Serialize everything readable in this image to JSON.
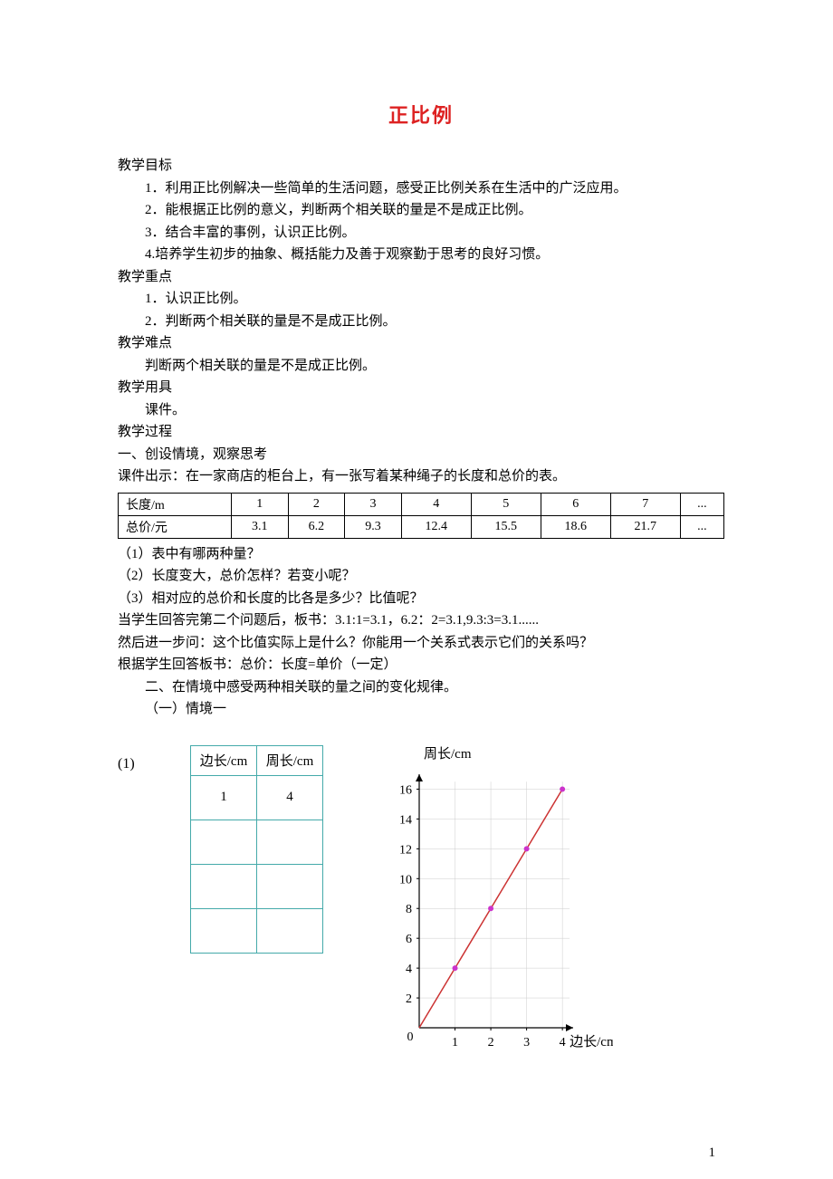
{
  "title": "正比例",
  "sections": {
    "objectives_label": "教学目标",
    "objectives": [
      "1．利用正比例解决一些简单的生活问题，感受正比例关系在生活中的广泛应用。",
      "2．能根据正比例的意义，判断两个相关联的量是不是成正比例。",
      "3．结合丰富的事例，认识正比例。",
      "4.培养学生初步的抽象、概括能力及善于观察勤于思考的良好习惯。"
    ],
    "keypoints_label": "教学重点",
    "keypoints": [
      "1．认识正比例。",
      "2．判断两个相关联的量是不是成正比例。"
    ],
    "difficulty_label": "教学难点",
    "difficulty": "判断两个相关联的量是不是成正比例。",
    "materials_label": "教学用具",
    "materials": "课件。",
    "process_label": "教学过程",
    "part1_heading": "一、创设情境，观察思考",
    "part1_intro": "课件出示：在一家商店的柜台上，有一张写着某种绳子的长度和总价的表。",
    "table1": {
      "row_headers": [
        "长度/m",
        "总价/元"
      ],
      "cols": [
        "1",
        "2",
        "3",
        "4",
        "5",
        "6",
        "7",
        "..."
      ],
      "row2": [
        "3.1",
        "6.2",
        "9.3",
        "12.4",
        "15.5",
        "18.6",
        "21.7",
        "..."
      ]
    },
    "q1": "（1）表中有哪两种量？",
    "q2": "（2）长度变大，总价怎样？若变小呢？",
    "q3": "（3）相对应的总价和长度的比各是多少？比值呢？",
    "followup1": "当学生回答完第二个问题后，板书：3.1:1=3.1，6.2：2=3.1,9.3:3=3.1......",
    "followup2": "然后进一步问：这个比值实际上是什么？你能用一个关系式表示它们的关系吗？",
    "followup3": "根据学生回答板书：总价：长度=单价（一定）",
    "part2_heading": "二、在情境中感受两种相关联的量之间的变化规律。",
    "part2_sub": "（一）情境一",
    "item_label": "(1)",
    "table2": {
      "headers": [
        "边长/cm",
        "周长/cm"
      ],
      "rows": [
        [
          "1",
          "4"
        ],
        [
          "",
          ""
        ],
        [
          "",
          ""
        ],
        [
          "",
          ""
        ]
      ]
    }
  },
  "chart_data": {
    "type": "line",
    "title": "周长/cm",
    "xlabel": "边长/cm",
    "ylabel": "",
    "x": [
      0,
      1,
      2,
      3,
      4
    ],
    "y": [
      0,
      4,
      8,
      12,
      16
    ],
    "xticks": [
      1,
      2,
      3,
      4
    ],
    "yticks": [
      2,
      4,
      6,
      8,
      10,
      12,
      14,
      16
    ],
    "xlim": [
      0,
      4.3
    ],
    "ylim": [
      0,
      17
    ]
  },
  "page_number": "1"
}
